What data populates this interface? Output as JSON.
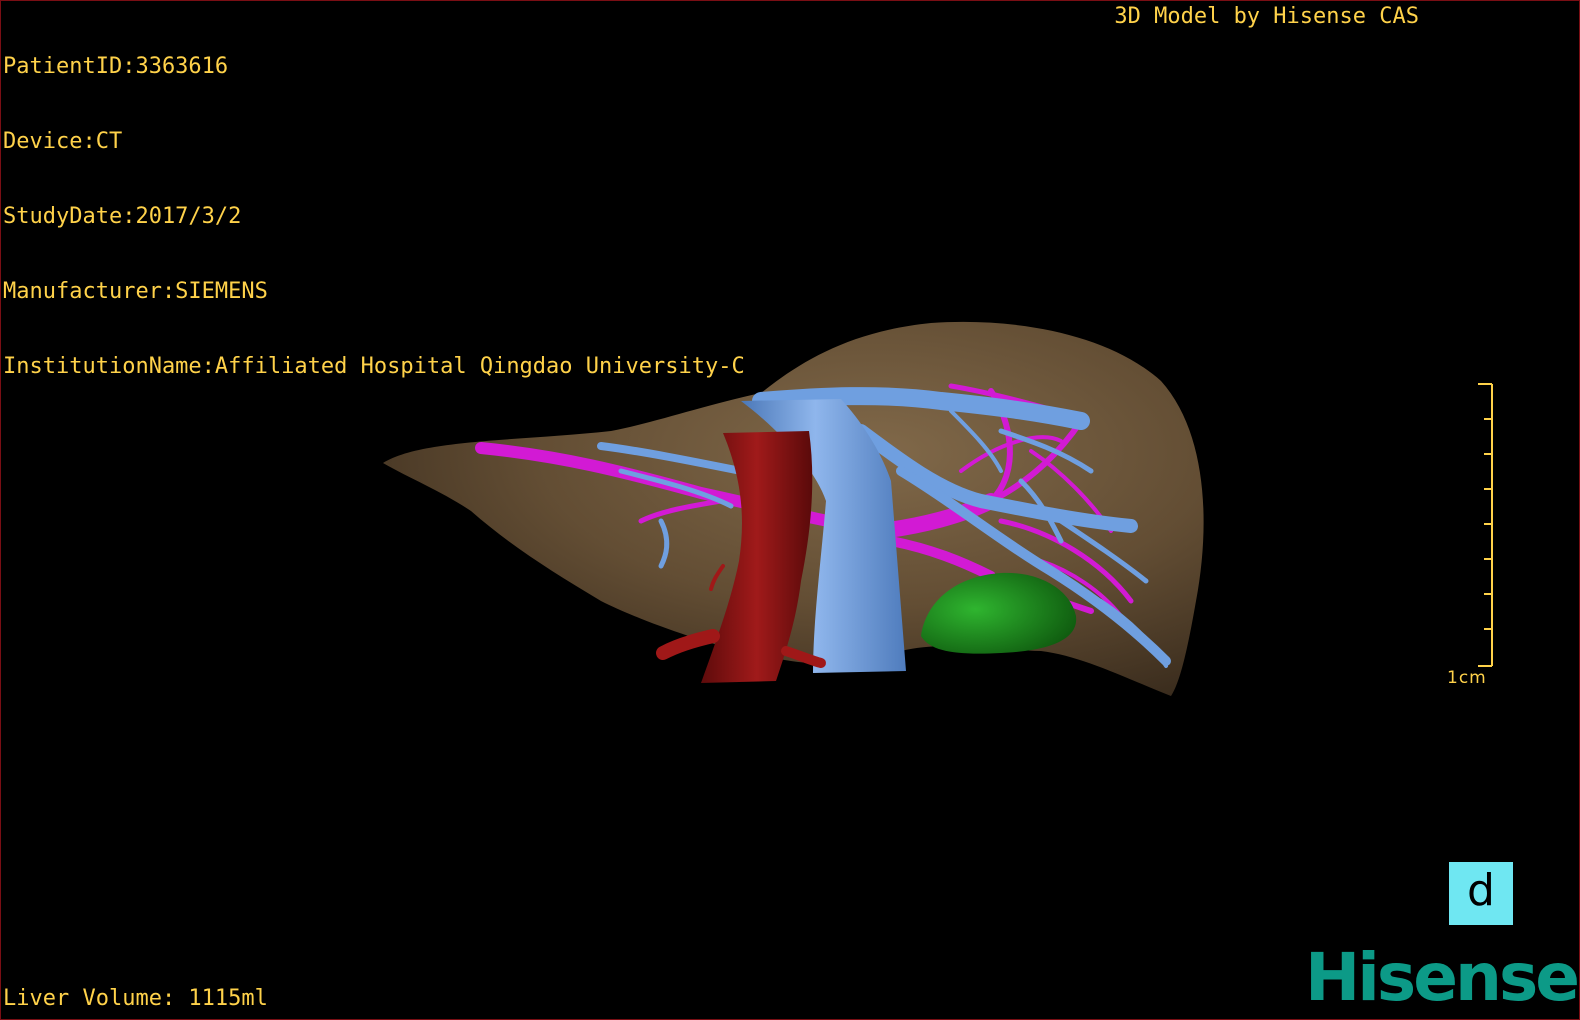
{
  "patient_info": {
    "patient_id": "PatientID:3363616",
    "device": "Device:CT",
    "study_date": "StudyDate:2017/3/2",
    "manufacturer": "Manufacturer:SIEMENS",
    "institution": "InstitutionName:Affiliated Hospital Qingdao University-C"
  },
  "credit": "3D Model by Hisense CAS",
  "liver_volume": "Liver Volume: 1115ml",
  "scale": {
    "label": "1cm"
  },
  "view_badge": "d",
  "logo_text": "Hisense",
  "colors": {
    "overlay_text": "#ffd24a",
    "liver": "#7a6244",
    "hepatic_vein": "#6f9fe0",
    "portal_vein": "#d21ad4",
    "artery": "#8e1414",
    "gallbladder": "#1f8a1f",
    "badge": "#6fe7f2",
    "logo": "#0c9a87"
  }
}
